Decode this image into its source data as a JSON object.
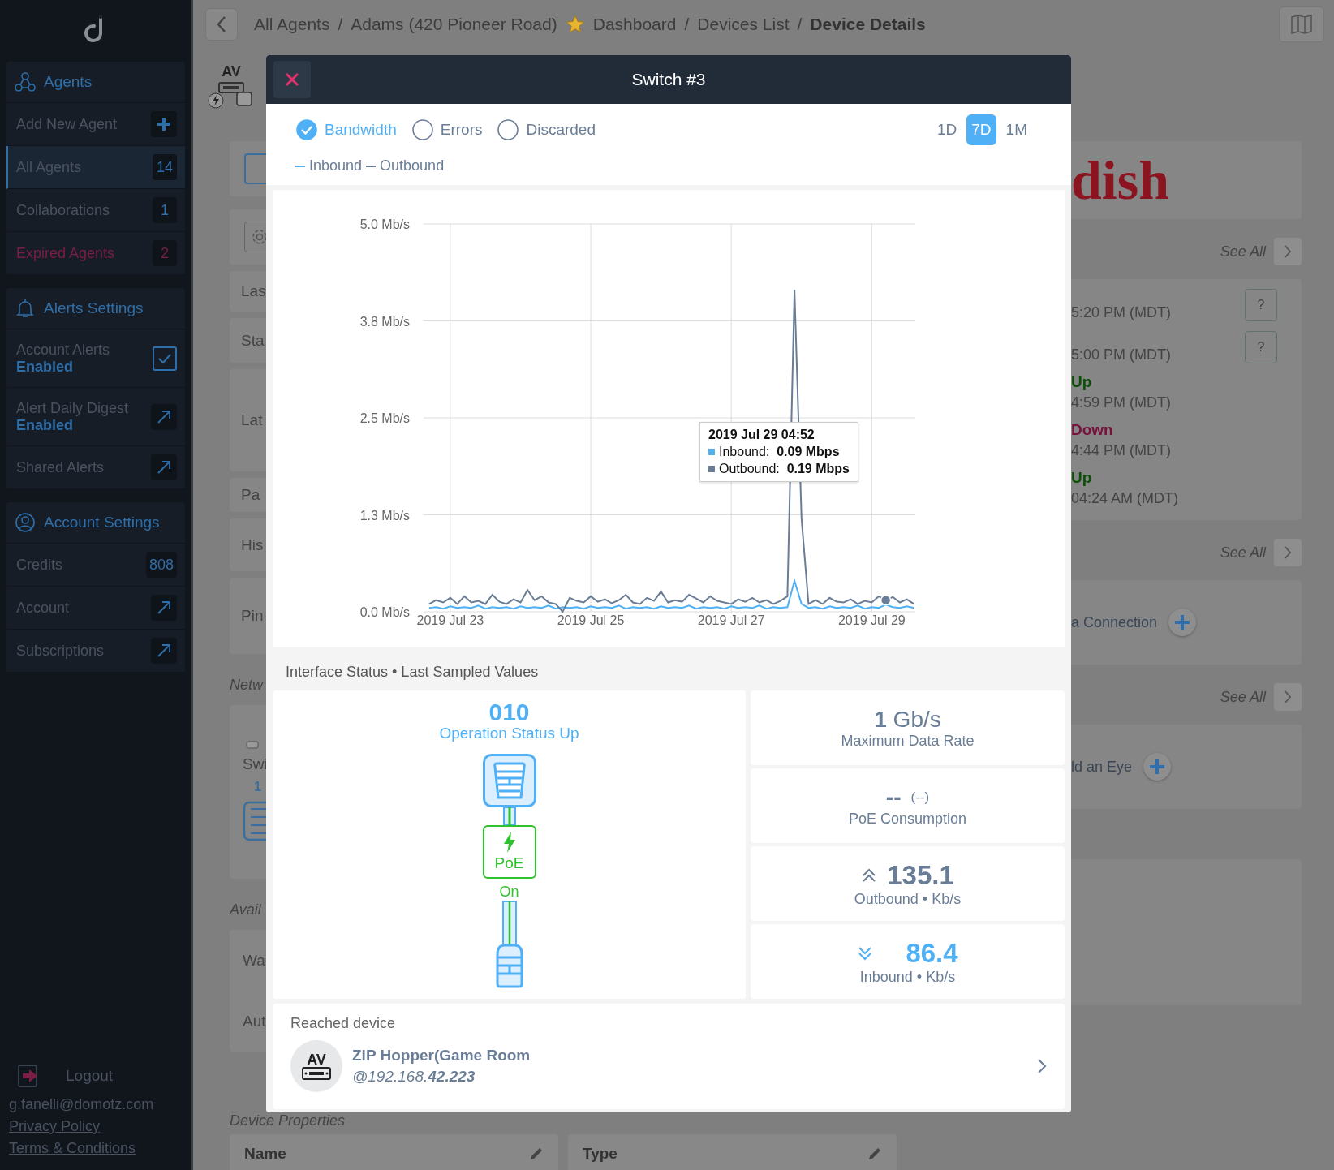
{
  "sidebar": {
    "sections": [
      {
        "kind": "agents",
        "title": "Agents",
        "items": [
          {
            "label": "Add New Agent",
            "kind": "add",
            "selected": false,
            "warning": false
          },
          {
            "label": "All Agents",
            "kind": "count",
            "count": "14",
            "selected": true,
            "warning": false
          },
          {
            "label": "Collaborations",
            "kind": "count",
            "count": "1",
            "selected": false,
            "warning": false
          },
          {
            "label": "Expired Agents",
            "kind": "count",
            "count": "2",
            "selected": false,
            "warning": true
          }
        ]
      },
      {
        "kind": "alerts",
        "title": "Alerts Settings",
        "items": [
          {
            "label": "Account Alerts",
            "status": "Enabled",
            "kind": "check",
            "checked": true,
            "selected": false,
            "warning": false
          },
          {
            "label": "Alert Daily Digest",
            "status": "Enabled",
            "kind": "link",
            "selected": false,
            "warning": false
          },
          {
            "label": "Shared Alerts",
            "kind": "link",
            "selected": false,
            "warning": false
          }
        ]
      },
      {
        "kind": "account",
        "title": "Account Settings",
        "items": [
          {
            "label": "Credits",
            "kind": "count",
            "count": "808",
            "selected": false,
            "warning": false
          },
          {
            "label": "Account",
            "kind": "link",
            "selected": false,
            "warning": false
          },
          {
            "label": "Subscriptions",
            "kind": "link",
            "selected": false,
            "warning": false
          }
        ]
      }
    ],
    "footer": {
      "logout": "Logout",
      "email": "g.fanelli@domotz.com",
      "links": [
        "Privacy Policy",
        "Terms & Conditions"
      ]
    }
  },
  "breadcrumb": [
    {
      "label": "All Agents",
      "current": false,
      "starred": false,
      "separator": "/"
    },
    {
      "label": "Adams (420 Pioneer Road)",
      "current": false,
      "starred": true
    },
    {
      "label": "Dashboard",
      "current": false,
      "starred": false,
      "separator": "/"
    },
    {
      "label": "Devices List",
      "current": false,
      "starred": false,
      "separator": "/"
    },
    {
      "label": "Device Details",
      "current": true,
      "starred": false
    }
  ],
  "background": {
    "left": {
      "device_label": "AV",
      "rows": [
        "Las",
        "Sta",
        "Lat",
        "Pa",
        "His",
        "Pin"
      ],
      "network_title": "Netw",
      "network_item": "Swi",
      "network_count": "1",
      "available_title": "Avail",
      "available_rows": [
        "Wa",
        "Aut"
      ]
    },
    "right": {
      "logo": "dish",
      "groups": [
        {
          "see_all": "See All",
          "events": [
            {
              "time": "5:20 PM (MDT)",
              "help": "?"
            },
            {
              "time": "5:00 PM (MDT)",
              "help": "?"
            },
            {
              "state": "Up",
              "kind": "up",
              "time": "4:59 PM (MDT)"
            },
            {
              "state": "Down",
              "kind": "down",
              "time": "4:44 PM (MDT)"
            },
            {
              "state": "Up",
              "kind": "up",
              "time": "04:24 AM (MDT)"
            }
          ]
        },
        {
          "see_all": "See All",
          "action": "a Connection"
        },
        {
          "see_all": "See All",
          "action": "ld an Eye"
        }
      ]
    },
    "bottom": {
      "title": "Device Properties",
      "columns": [
        "Name",
        "Type"
      ]
    }
  },
  "modal": {
    "title": "Switch #3",
    "metrics": [
      {
        "label": "Bandwidth",
        "selected": true
      },
      {
        "label": "Errors",
        "selected": false
      },
      {
        "label": "Discarded",
        "selected": false
      }
    ],
    "ranges": [
      {
        "label": "1D",
        "selected": false
      },
      {
        "label": "7D",
        "selected": true
      },
      {
        "label": "1M",
        "selected": false
      }
    ],
    "chart": {
      "chart_data": {
        "type": "line",
        "grid": true,
        "ylim": [
          0,
          5
        ],
        "yticks": [
          {
            "value": 0,
            "label": "0.0 Mb/s"
          },
          {
            "value": 1.25,
            "label": "1.3 Mb/s"
          },
          {
            "value": 2.5,
            "label": "2.5 Mb/s"
          },
          {
            "value": 3.75,
            "label": "3.8 Mb/s"
          },
          {
            "value": 5,
            "label": "5.0 Mb/s"
          }
        ],
        "categories": [
          null,
          null,
          null,
          "2019 Jul 23",
          null,
          null,
          null,
          null,
          null,
          null,
          null,
          null,
          null,
          null,
          null,
          null,
          null,
          null,
          null,
          null,
          null,
          null,
          null,
          "2019 Jul 25",
          null,
          null,
          null,
          null,
          null,
          null,
          null,
          null,
          null,
          null,
          null,
          null,
          null,
          null,
          null,
          null,
          null,
          null,
          null,
          "2019 Jul 27",
          null,
          null,
          null,
          null,
          null,
          null,
          null,
          null,
          null,
          null,
          null,
          null,
          null,
          null,
          null,
          null,
          null,
          null,
          null,
          "2019 Jul 29",
          null,
          null,
          null,
          null,
          null,
          null
        ],
        "series": [
          {
            "name": "Inbound",
            "color": "#4fb0f5",
            "values": [
              0.05,
              0.06,
              0.04,
              0.07,
              0.05,
              0.06,
              0.05,
              0.08,
              0.04,
              0.06,
              0.05,
              0.06,
              0.04,
              0.07,
              0.05,
              0.06,
              0.05,
              0.08,
              0.04,
              0.06,
              0.05,
              0.06,
              0.04,
              0.07,
              0.05,
              0.06,
              0.05,
              0.08,
              0.04,
              0.06,
              0.05,
              0.06,
              0.04,
              0.07,
              0.05,
              0.06,
              0.05,
              0.08,
              0.04,
              0.06,
              0.05,
              0.06,
              0.04,
              0.07,
              0.05,
              0.06,
              0.05,
              0.08,
              0.04,
              0.06,
              0.05,
              0.06,
              0.4,
              0.1,
              0.05,
              0.06,
              0.04,
              0.07,
              0.05,
              0.06,
              0.05,
              0.08,
              0.04,
              0.06,
              0.05,
              0.09,
              0.06,
              0.05,
              0.07,
              0.05
            ]
          },
          {
            "name": "Outbound",
            "color": "#6a7d96",
            "values": [
              0.1,
              0.15,
              0.12,
              0.18,
              0.1,
              0.2,
              0.12,
              0.14,
              0.1,
              0.22,
              0.13,
              0.1,
              0.16,
              0.12,
              0.28,
              0.15,
              0.2,
              0.12,
              0.1,
              0.0,
              0.18,
              0.14,
              0.12,
              0.2,
              0.13,
              0.16,
              0.11,
              0.15,
              0.22,
              0.12,
              0.1,
              0.18,
              0.14,
              0.26,
              0.12,
              0.15,
              0.13,
              0.22,
              0.17,
              0.12,
              0.2,
              0.14,
              0.12,
              0.1,
              0.16,
              0.13,
              0.18,
              0.12,
              0.15,
              0.1,
              0.14,
              0.2,
              4.15,
              1.2,
              0.1,
              0.15,
              0.1,
              0.18,
              0.13,
              0.12,
              0.16,
              0.1,
              0.14,
              0.12,
              0.2,
              0.15,
              0.19,
              0.12,
              0.16,
              0.1
            ]
          }
        ]
      },
      "tooltip": {
        "title": "2019 Jul 29 04:52",
        "rows": [
          {
            "label": "Inbound:",
            "value": "0.09 Mbps"
          },
          {
            "label": "Outbound:",
            "value": "0.19 Mbps"
          }
        ]
      }
    },
    "status": {
      "title": "Interface Status • Last Sampled Values",
      "code": "010",
      "code_label": "Operation Status Up",
      "poe_label": "PoE",
      "poe_state": "On",
      "poe_on": true,
      "cards": [
        {
          "kind": "rate",
          "value": "**1** Gb/s",
          "label": "Maximum Data Rate"
        },
        {
          "kind": "poe",
          "value": "--",
          "extra": "(--)",
          "label": "PoE Consumption"
        },
        {
          "kind": "out",
          "value": "135.1",
          "label": "Outbound • Kb/s"
        },
        {
          "kind": "in",
          "value": "86.4",
          "label": "Inbound • Kb/s"
        }
      ]
    },
    "reached": {
      "title": "Reached device",
      "avatar_label": "AV",
      "name": "ZiP Hopper(Game Room",
      "address": "@192.168.**42.223**"
    }
  }
}
